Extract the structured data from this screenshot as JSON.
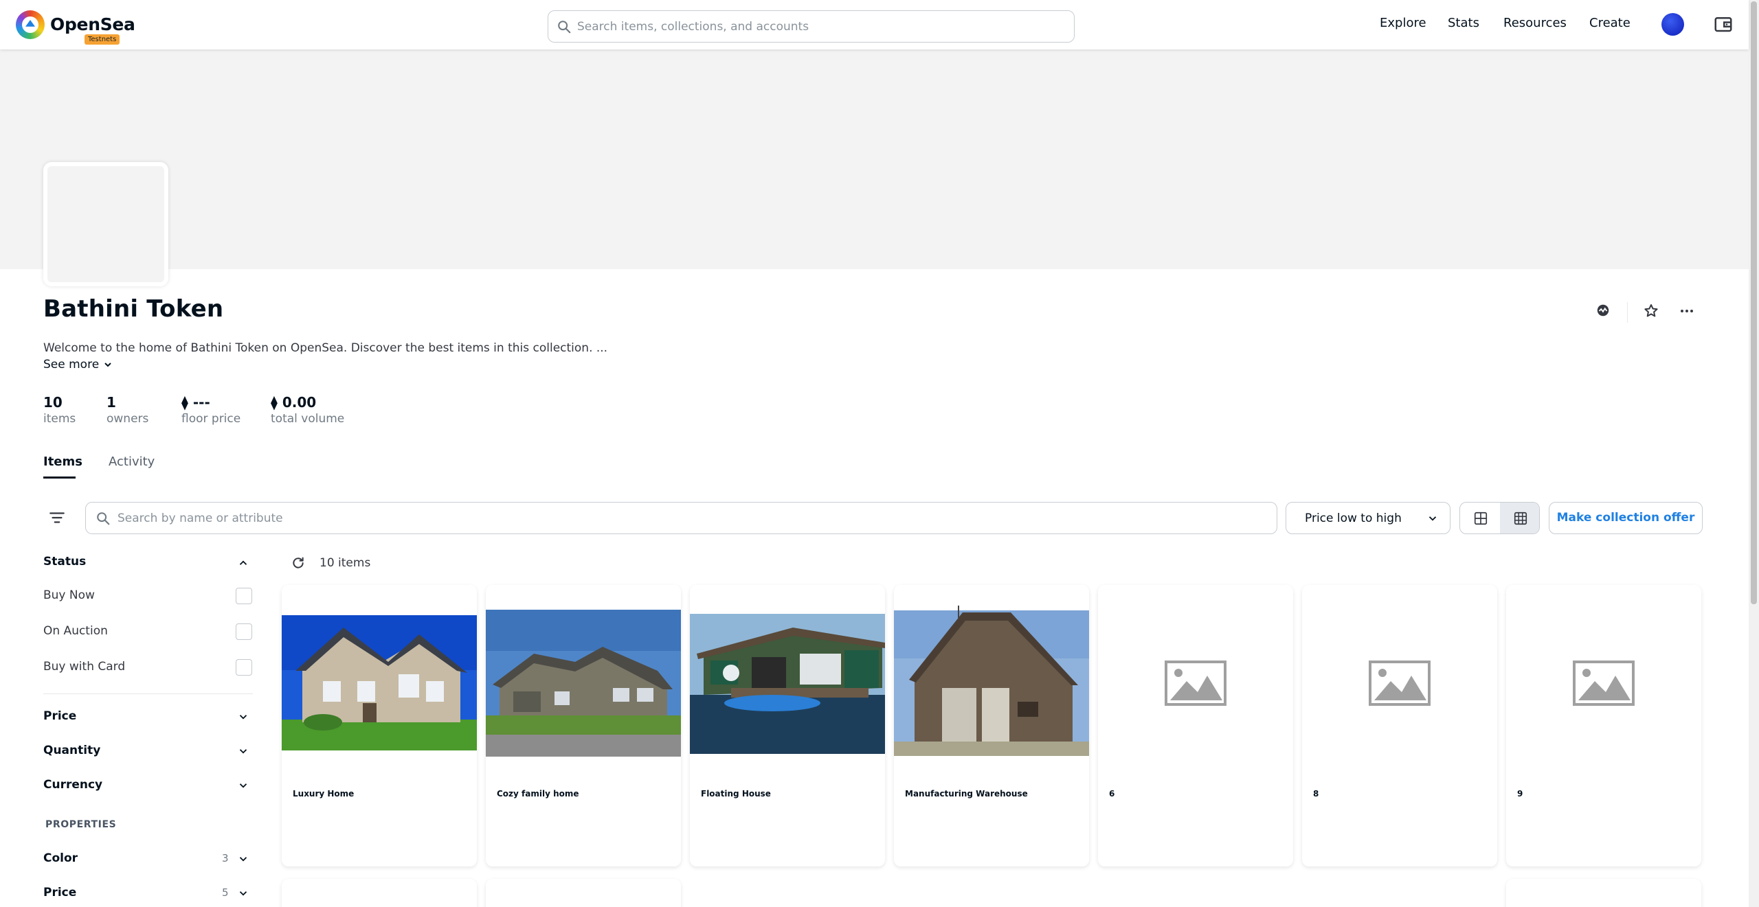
{
  "nav": {
    "brand": "OpenSea",
    "badge": "Testnets",
    "search_placeholder": "Search items, collections, and accounts",
    "links": [
      "Explore",
      "Stats",
      "Resources",
      "Create"
    ]
  },
  "collection": {
    "name": "Bathini Token",
    "description": "Welcome to the home of Bathini Token on OpenSea. Discover the best items in this collection. ...",
    "see_more": "See more",
    "stats": [
      {
        "value": "10",
        "label": "items"
      },
      {
        "value": "1",
        "label": "owners"
      },
      {
        "value": "⧫ ---",
        "label": "floor price"
      },
      {
        "value": "⧫ 0.00",
        "label": "total volume"
      }
    ]
  },
  "tabs": [
    "Items",
    "Activity"
  ],
  "toolbar": {
    "search_placeholder": "Search by name or attribute",
    "sort_label": "Price low to high",
    "offer_label": "Make collection offer"
  },
  "sidebar": {
    "status_title": "Status",
    "status_options": [
      "Buy Now",
      "On Auction",
      "Buy with Card"
    ],
    "sections": [
      "Price",
      "Quantity",
      "Currency"
    ],
    "properties_title": "PROPERTIES",
    "properties": [
      {
        "name": "Color",
        "count": "3"
      },
      {
        "name": "Price",
        "count": "5"
      }
    ]
  },
  "grid": {
    "count_label": "10 items",
    "items": [
      {
        "name": "Luxury Home",
        "image": "photo-house-large"
      },
      {
        "name": "Cozy family home",
        "image": "photo-house-ranch"
      },
      {
        "name": "Floating House",
        "image": "photo-houseboat"
      },
      {
        "name": "Manufacturing Warehouse",
        "image": "photo-barn-warehouse"
      },
      {
        "name": "6",
        "image": "placeholder-image-icon"
      },
      {
        "name": "8",
        "image": "placeholder-image-icon"
      },
      {
        "name": "9",
        "image": "placeholder-image-icon"
      }
    ]
  },
  "colors": {
    "accent": "#2081e2",
    "badge": "#f6a233",
    "avatar": "#1a2fc9",
    "banner": "#f3f3f3"
  }
}
